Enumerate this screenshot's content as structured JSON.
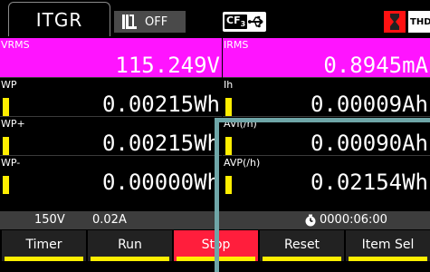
{
  "header": {
    "mode_label": "ITGR",
    "range_status": "OFF",
    "cf_label": "CF",
    "cf_sub": "3",
    "thd_label": "THD"
  },
  "panels": {
    "vrms": {
      "label": "VRMS",
      "value": "115.249V"
    },
    "irms": {
      "label": "IRMS",
      "value": "0.8945mA"
    },
    "wp": {
      "label": "WP",
      "value": "0.00215Wh"
    },
    "ih": {
      "label": "Ih",
      "value": "0.00009Ah"
    },
    "wp_plus": {
      "label": "WP+",
      "value": "0.00215Wh"
    },
    "avi": {
      "label": "AVI(/h)",
      "value": "0.00090Ah"
    },
    "wp_minus": {
      "label": "WP-",
      "value": "0.00000Wh"
    },
    "avp": {
      "label": "AVP(/h)",
      "value": "0.02154Wh"
    }
  },
  "status": {
    "voltage_range": "150V",
    "current_range": "0.02A",
    "elapsed_time": "0000:06:00"
  },
  "softkeys": {
    "timer": "Timer",
    "run": "Run",
    "stop": "Stop",
    "reset": "Reset",
    "item_sel": "Item Sel"
  },
  "colors": {
    "magenta": "#ff14ff",
    "accent_yellow": "#ffee00",
    "active_red": "#ff1e3c",
    "teal_frame": "#6fa6a8"
  }
}
